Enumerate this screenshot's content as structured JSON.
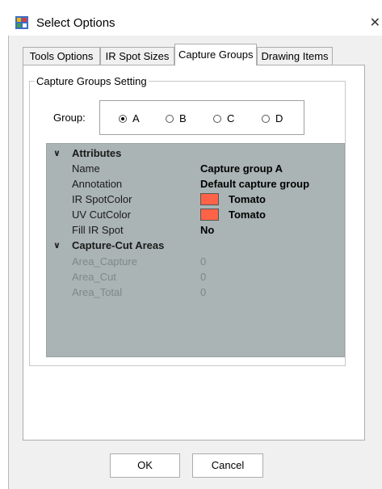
{
  "window": {
    "title": "Select Options",
    "close_glyph": "✕"
  },
  "tabs": [
    {
      "label": "Tools Options"
    },
    {
      "label": "IR Spot Sizes"
    },
    {
      "label": "Capture Groups"
    },
    {
      "label": "Drawing Items"
    }
  ],
  "active_tab": "Capture Groups",
  "capture_settings": {
    "legend": "Capture Groups Setting",
    "group_label": "Group:",
    "options": [
      "A",
      "B",
      "C",
      "D"
    ],
    "selected": "A"
  },
  "properties": {
    "attributes": {
      "title": "Attributes",
      "rows": [
        {
          "name": "Name",
          "value": "Capture group A"
        },
        {
          "name": "Annotation",
          "value": "Default capture group"
        },
        {
          "name": "IR SpotColor",
          "value": "Tomato",
          "color": "#ff6347"
        },
        {
          "name": "UV CutColor",
          "value": "Tomato",
          "color": "#ff6347"
        },
        {
          "name": "Fill IR Spot",
          "value": "No"
        }
      ]
    },
    "areas": {
      "title": "Capture-Cut Areas",
      "rows": [
        {
          "name": "Area_Capture",
          "value": "0"
        },
        {
          "name": "Area_Cut",
          "value": "0"
        },
        {
          "name": "Area_Total",
          "value": "0"
        }
      ]
    }
  },
  "buttons": {
    "ok": "OK",
    "cancel": "Cancel"
  },
  "colors": {
    "grid_bg": "#aab4b4",
    "swatch": "#ff6347"
  }
}
